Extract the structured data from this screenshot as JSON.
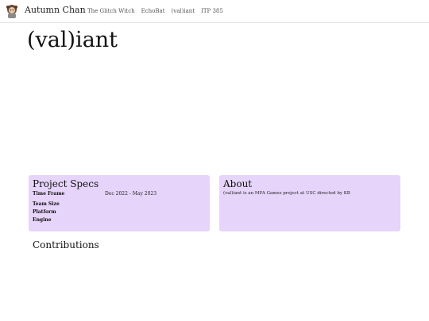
{
  "nav": {
    "site_name": "Autumn Chan",
    "links": [
      "The Glitch Witch",
      "EchoBat",
      "(val)iant",
      "ITP 385"
    ]
  },
  "page": {
    "title": "(val)iant"
  },
  "specs": {
    "heading": "Project Specs",
    "rows": [
      {
        "label": "Time Frame",
        "value": "Dec 2022 - May 2023"
      },
      {
        "label": "Team Size",
        "value": ""
      },
      {
        "label": "Platform",
        "value": ""
      },
      {
        "label": "Engine",
        "value": ""
      }
    ]
  },
  "about": {
    "heading": "About",
    "text": "(val)iant is an MFA Games project at USC directed by KB"
  },
  "contributions": {
    "heading": "Contributions"
  },
  "colors": {
    "card_bg": "#e6d4fa",
    "border": "#e5e5e5"
  },
  "icons": {
    "avatar": "avatar-portrait-icon"
  }
}
